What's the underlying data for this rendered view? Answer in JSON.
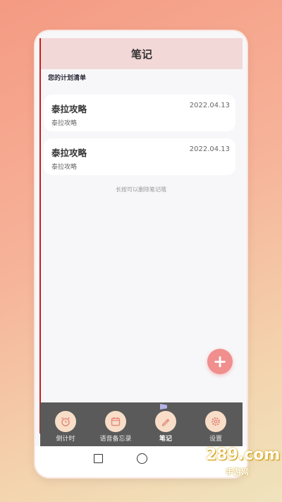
{
  "app": {
    "title": "笔记",
    "section_title": "您的计划清单",
    "hint": "长按可以删除笔记哦",
    "add_symbol": "+"
  },
  "notes": [
    {
      "title": "泰拉攻略",
      "date": "2022.04.13",
      "subtitle": "泰拉攻略"
    },
    {
      "title": "泰拉攻略",
      "date": "2022.04.13",
      "subtitle": "泰拉攻略"
    }
  ],
  "tabs": [
    {
      "label": "倒计时",
      "icon": "alarm-clock-icon"
    },
    {
      "label": "语音备忘录",
      "icon": "calendar-icon"
    },
    {
      "label": "笔记",
      "icon": "pen-icon",
      "active": true
    },
    {
      "label": "设置",
      "icon": "gear-icon"
    }
  ],
  "watermark": {
    "main": "289.com",
    "sub": "手游网"
  },
  "colors": {
    "header_bg": "#f2d8d7",
    "fab": "#f08f8d",
    "tabbar_bg": "#5a5a5a",
    "tab_icon_bg": "#f8dec8",
    "icon_accent": "#e58a7c"
  }
}
